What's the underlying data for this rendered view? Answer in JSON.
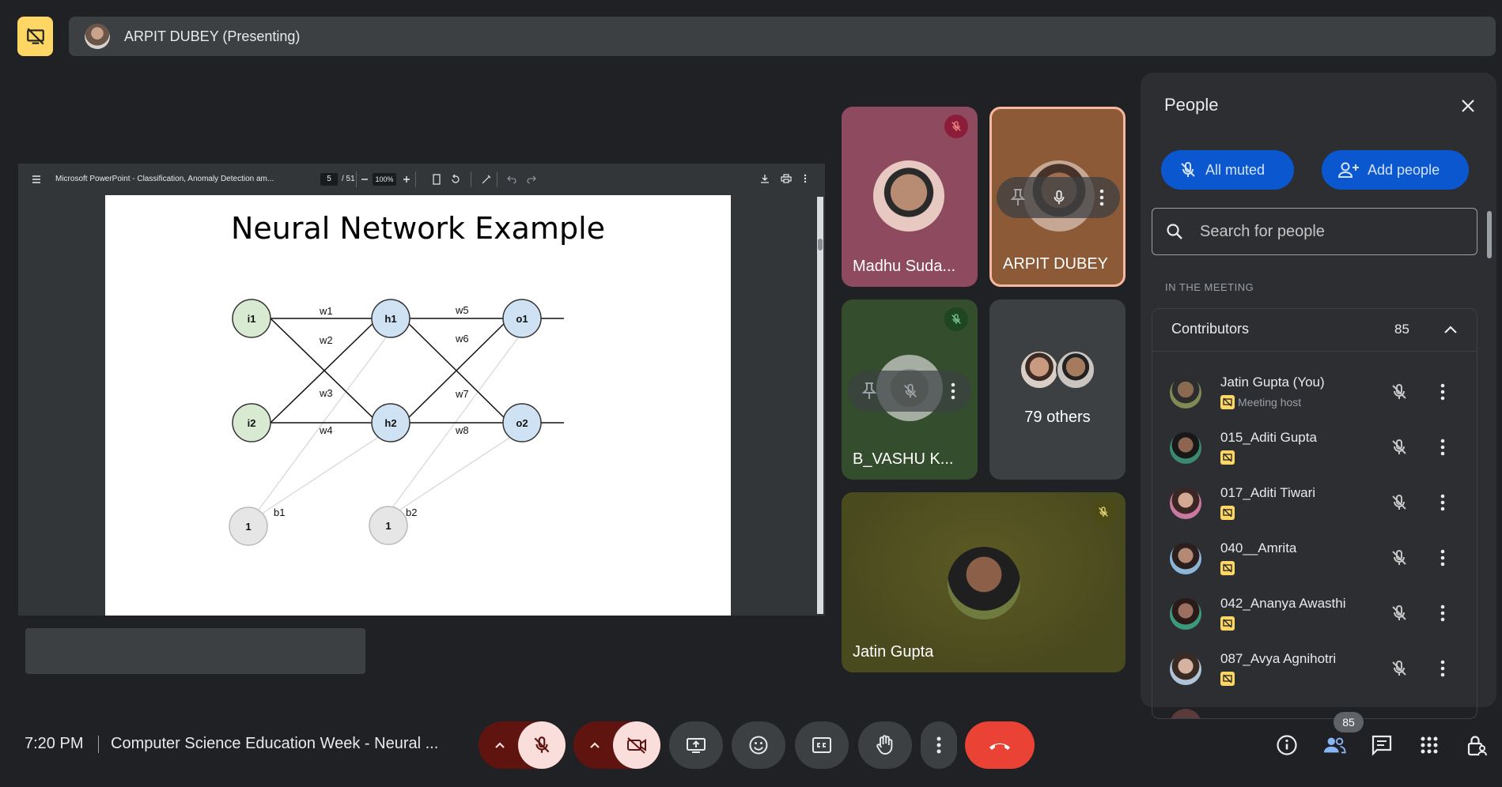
{
  "presenter_bar": {
    "label": "ARPIT DUBEY (Presenting)",
    "icon": "stop-presenting-icon"
  },
  "pdf_viewer": {
    "doc_title": "Microsoft PowerPoint - Classification, Anomaly Detection am...",
    "page_current": "5",
    "page_total": "/ 51",
    "zoom": "100%"
  },
  "slide": {
    "title": "Neural Network Example",
    "nodes": {
      "i1": "i1",
      "i2": "i2",
      "h1": "h1",
      "h2": "h2",
      "o1": "o1",
      "o2": "o2",
      "bias1": "1",
      "bias2": "1"
    },
    "weights": {
      "w1": "w1",
      "w2": "w2",
      "w3": "w3",
      "w4": "w4",
      "w5": "w5",
      "w6": "w6",
      "w7": "w7",
      "w8": "w8",
      "b1": "b1",
      "b2": "b2"
    }
  },
  "tiles": {
    "madhu": "Madhu Suda...",
    "arpit": "ARPIT DUBEY",
    "vashu": "B_VASHU K...",
    "others": "79 others",
    "jatin": "Jatin Gupta"
  },
  "people_panel": {
    "title": "People",
    "all_muted": "All muted",
    "add_people": "Add people",
    "search_placeholder": "Search for people",
    "section": "IN THE MEETING",
    "contributors_label": "Contributors",
    "contributors_count": "85",
    "participants": [
      {
        "name": "Jatin Gupta (You)",
        "sub": "Meeting host"
      },
      {
        "name": "015_Aditi Gupta",
        "sub": ""
      },
      {
        "name": "017_Aditi Tiwari",
        "sub": ""
      },
      {
        "name": "040__Amrita",
        "sub": ""
      },
      {
        "name": "042_Ananya Awasthi",
        "sub": ""
      },
      {
        "name": "087_Avya Agnihotri",
        "sub": ""
      }
    ]
  },
  "bottom_bar": {
    "time": "7:20 PM",
    "meeting_title": "Computer Science Education Week - Neural ...",
    "people_badge": "85"
  },
  "colors": {
    "background": "#202124",
    "surface": "#3c4043",
    "accent_yellow": "#fdd663",
    "end_call_red": "#ea4335",
    "blue_pill": "#0b57d0",
    "mic_off_bg": "#f9dedc"
  }
}
